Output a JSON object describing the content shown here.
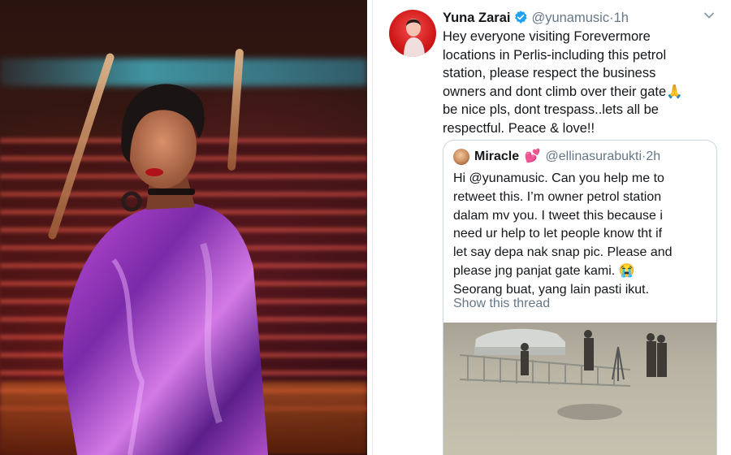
{
  "photo": {
    "icon": "portrait-photo"
  },
  "tweet": {
    "display_name": "Yuna Zarai",
    "handle": "@yunamusic",
    "separator": "·",
    "time": "1h",
    "lines": [
      "Hey everyone visiting Forevermore",
      "locations in Perlis-including this petrol",
      "station, please respect the business",
      "owners and dont climb over their gate🙏",
      "be nice pls, dont trespass..lets all be",
      "respectful. Peace & love!!"
    ],
    "colors": {
      "name": "#14171a",
      "meta": "#657786",
      "verified": "#1da1f2",
      "avatar": "#d01818"
    }
  },
  "quote": {
    "display_name": "Miracle",
    "emoji": "💕",
    "handle": "@ellinasurabukti",
    "separator": "·",
    "time": "2h",
    "lines": [
      "Hi @yunamusic. Can you help me to",
      "retweet this. I’m owner petrol station",
      "dalam mv you. I tweet this because i",
      "need ur help to let people know tht if",
      "let say depa nak snap pic. Please and",
      "please jng panjat gate kami. 😭",
      "Seorang buat, yang lain pasti ikut."
    ],
    "show_thread": "Show this thread",
    "image_icon": "cctv-screenshot"
  }
}
